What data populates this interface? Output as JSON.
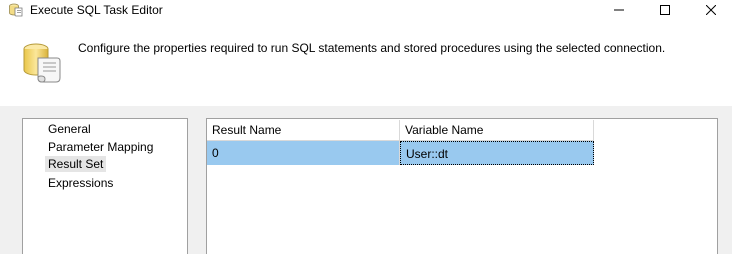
{
  "window": {
    "title": "Execute SQL Task Editor",
    "icon": "sql-task-icon"
  },
  "banner": {
    "icon": "database-scroll-icon",
    "description": "Configure the properties required to run SQL statements and stored procedures using the selected connection."
  },
  "nav": {
    "items": [
      {
        "label": "General",
        "selected": false
      },
      {
        "label": "Parameter Mapping",
        "selected": false
      },
      {
        "label": "Result Set",
        "selected": true
      },
      {
        "label": "Expressions",
        "selected": false
      }
    ]
  },
  "result_set": {
    "columns": [
      "Result Name",
      "Variable Name"
    ],
    "rows": [
      {
        "result_name": "0",
        "variable_name": "User::dt",
        "selected": true
      }
    ]
  },
  "colors": {
    "selected_row": "#99c9ef",
    "selected_nav": "#e5e5e5",
    "content_background": "#f0f0f0"
  }
}
